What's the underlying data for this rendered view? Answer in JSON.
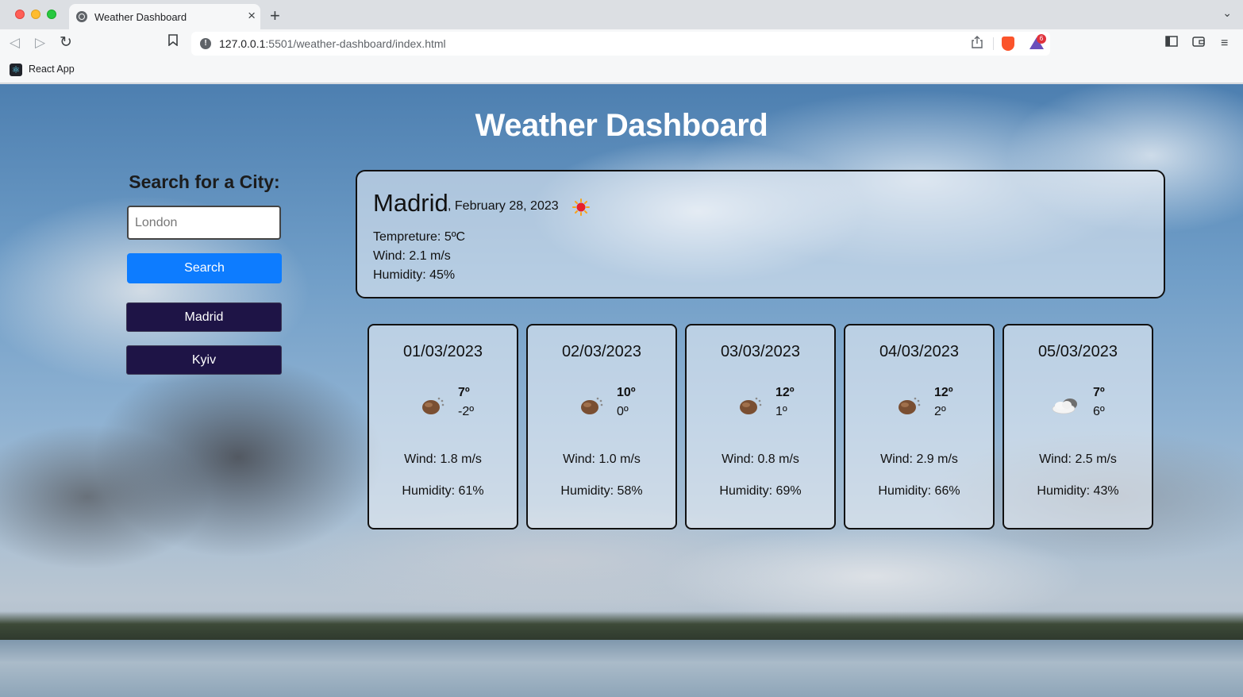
{
  "browser": {
    "tab_title": "Weather Dashboard",
    "url_host": "127.0.0.1",
    "url_rest": ":5501/weather-dashboard/index.html",
    "rewards_badge": "6",
    "bookmark_label": "React App"
  },
  "app": {
    "title": "Weather Dashboard"
  },
  "search": {
    "heading": "Search for a City:",
    "placeholder": "London",
    "value": "",
    "button_label": "Search",
    "history": [
      "Madrid",
      "Kyiv"
    ]
  },
  "current": {
    "city": "Madrid",
    "date": ", February 28, 2023",
    "icon": "sun-icon",
    "temperature": "Tempreture: 5ºC",
    "wind": "Wind: 2.1 m/s",
    "humidity": "Humidity: 45%"
  },
  "forecast": [
    {
      "date": "01/03/2023",
      "icon": "partly-sunny-icon",
      "high": "7º",
      "low": "-2º",
      "wind": "Wind: 1.8 m/s",
      "humidity": "Humidity: 61%"
    },
    {
      "date": "02/03/2023",
      "icon": "partly-sunny-icon",
      "high": "10º",
      "low": "0º",
      "wind": "Wind: 1.0 m/s",
      "humidity": "Humidity: 58%"
    },
    {
      "date": "03/03/2023",
      "icon": "partly-sunny-icon",
      "high": "12º",
      "low": "1º",
      "wind": "Wind: 0.8 m/s",
      "humidity": "Humidity: 69%"
    },
    {
      "date": "04/03/2023",
      "icon": "partly-sunny-icon",
      "high": "12º",
      "low": "2º",
      "wind": "Wind: 2.9 m/s",
      "humidity": "Humidity: 66%"
    },
    {
      "date": "05/03/2023",
      "icon": "cloudy-icon",
      "high": "7º",
      "low": "6º",
      "wind": "Wind: 2.5 m/s",
      "humidity": "Humidity: 43%"
    }
  ],
  "colors": {
    "search_button": "#0d7cff",
    "history_button": "#1e1446",
    "title_text": "#ffffff"
  }
}
